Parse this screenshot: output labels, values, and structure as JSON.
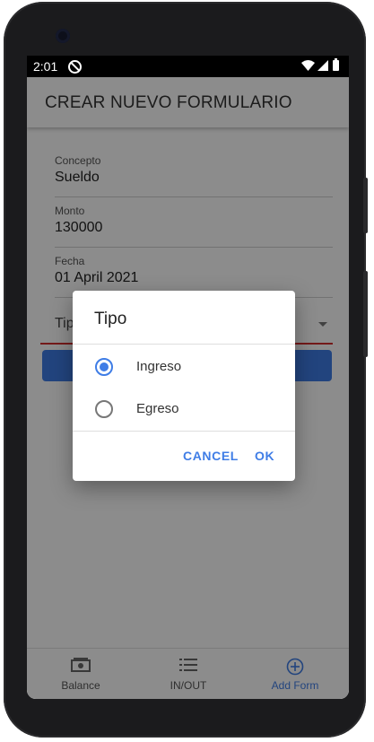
{
  "status_bar": {
    "time": "2:01"
  },
  "app_bar": {
    "title": "CREAR NUEVO FORMULARIO"
  },
  "form": {
    "fields": [
      {
        "label": "Concepto",
        "value": "Sueldo"
      },
      {
        "label": "Monto",
        "value": "130000"
      },
      {
        "label": "Fecha",
        "value": "01 April 2021"
      }
    ],
    "tipo_label": "Tipo"
  },
  "bottom_nav": [
    {
      "label": "Balance",
      "icon": "money-icon"
    },
    {
      "label": "IN/OUT",
      "icon": "list-icon"
    },
    {
      "label": "Add Form",
      "icon": "add-circle-icon",
      "active": true
    }
  ],
  "dialog": {
    "title": "Tipo",
    "options": [
      {
        "label": "Ingreso",
        "selected": true
      },
      {
        "label": "Egreso",
        "selected": false
      }
    ],
    "cancel_label": "CANCEL",
    "ok_label": "OK"
  },
  "colors": {
    "accent": "#3f7de6",
    "error_underline": "#d32f2f"
  }
}
